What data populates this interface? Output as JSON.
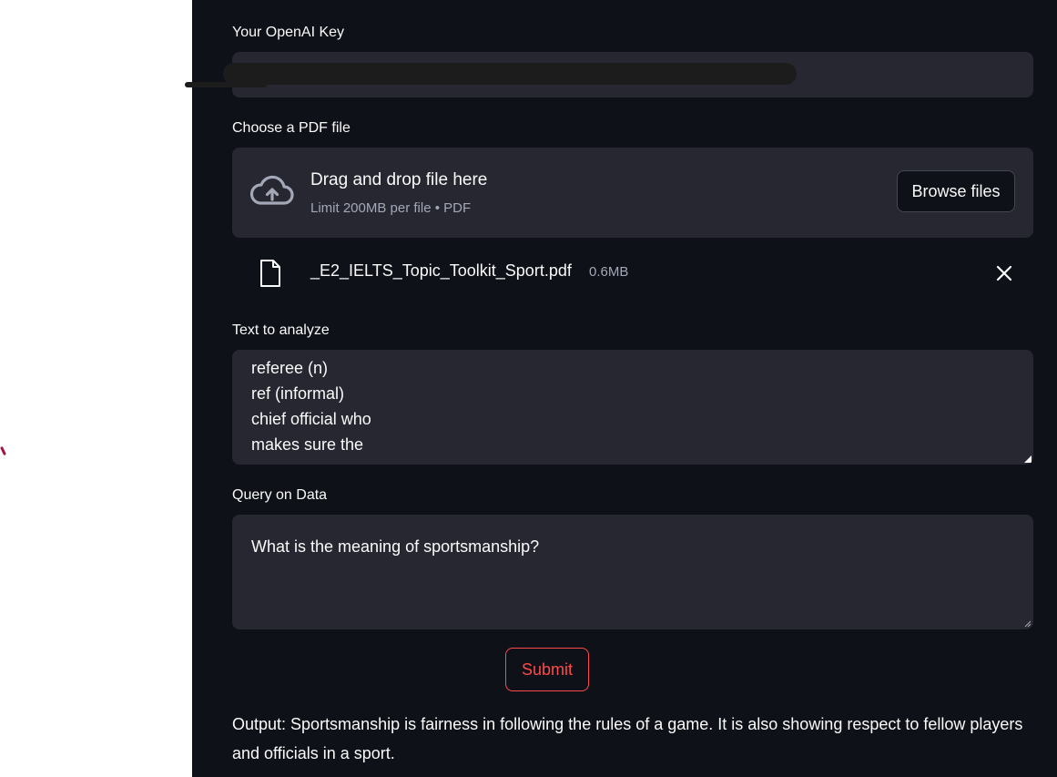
{
  "openai_key": {
    "label": "Your OpenAI Key",
    "value_redacted": true
  },
  "pdf_uploader": {
    "label": "Choose a PDF file",
    "drag_text": "Drag and drop file here",
    "limit_text": "Limit 200MB per file • PDF",
    "browse_label": "Browse files",
    "icon": "cloud-upload-icon"
  },
  "uploaded_file": {
    "name": "_E2_IELTS_Topic_Toolkit_Sport.pdf",
    "size": "0.6MB",
    "icon": "file-icon",
    "remove_icon": "close-icon"
  },
  "text_to_analyze": {
    "label": "Text to analyze",
    "lines": [
      "referee (n)",
      "ref (informal)",
      "chief official who",
      "makes sure the"
    ]
  },
  "query": {
    "label": "Query on Data",
    "value": "What is the meaning of sportsmanship?"
  },
  "submit": {
    "label": "Submit",
    "color": "#ff4b4b"
  },
  "output": {
    "text": "Output: Sportsmanship is fairness in following the rules of a game. It is also showing respect to fellow players and officials in a sport."
  },
  "colors": {
    "background": "#0e1117",
    "input_background": "#262730",
    "text": "#fafafa",
    "muted_text": "#a3a8b8"
  }
}
